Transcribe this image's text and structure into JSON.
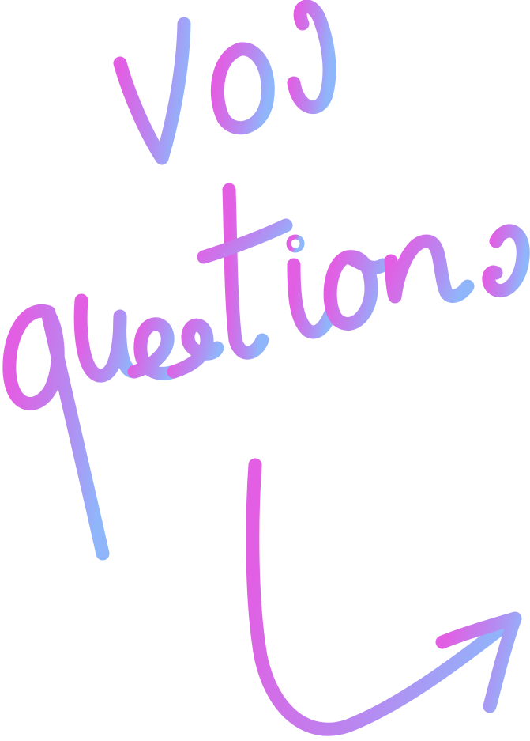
{
  "lettering": {
    "line1": "vos",
    "line2": "questions"
  },
  "colors": {
    "gradient_start": "#e25ee3",
    "gradient_mid": "#b887f0",
    "gradient_end": "#8fb6fb",
    "background": "#ffffff"
  },
  "icons": {
    "arrow": "curved-arrow-icon"
  }
}
